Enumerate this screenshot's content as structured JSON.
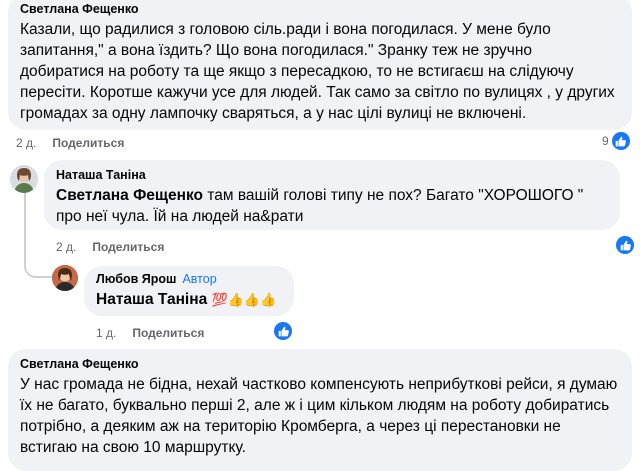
{
  "comment1": {
    "author": "Светлана Фещенко",
    "text": "Казали, що радилися з головою сіль.ради і вона погодилася. У мене було запитання,\" а вона їздить? Що вона погодилася.\" Зранку теж не зручно добиратися на роботу та ще якщо з пересадкою, то не встигаєш на слідуючу пересіти. Коротше кажучи усе для людей. Так само за світло по вулицях , у других громадах за одну лампочку сваряться, а у нас цілі вулиці не включені.",
    "time": "2 д.",
    "reply_label": "Поделиться",
    "reaction_count": "9"
  },
  "comment2": {
    "author": "Наташа Таніна",
    "mention": "Светлана Фещенко",
    "text": " там вашій голові типу не пох? Багато \"ХОРОШОГО \" про неї чула. Їй на людей на&рати",
    "time": "2 д.",
    "reply_label": "Поделиться"
  },
  "comment3": {
    "author": "Любов Ярош",
    "role": "Автор",
    "mention": "Наташа Таніна",
    "emojis": "💯👍👍👍",
    "time": "1 д.",
    "reply_label": "Поделиться"
  },
  "comment4": {
    "author": "Светлана Фещенко",
    "text": "У нас громада не бідна, нехай частково компенсують неприбуткові рейси, я думаю їх не багато, буквально перші 2, але ж і цим кільком людям на роботу добиратись потрібно, а деяким аж на територію Кромберга, а через ці перестановки не встигаю на свою 10 маршрутку."
  },
  "colors": {
    "like": "#1877f2",
    "bubble": "#f0f2f5",
    "meta": "#65676b"
  }
}
